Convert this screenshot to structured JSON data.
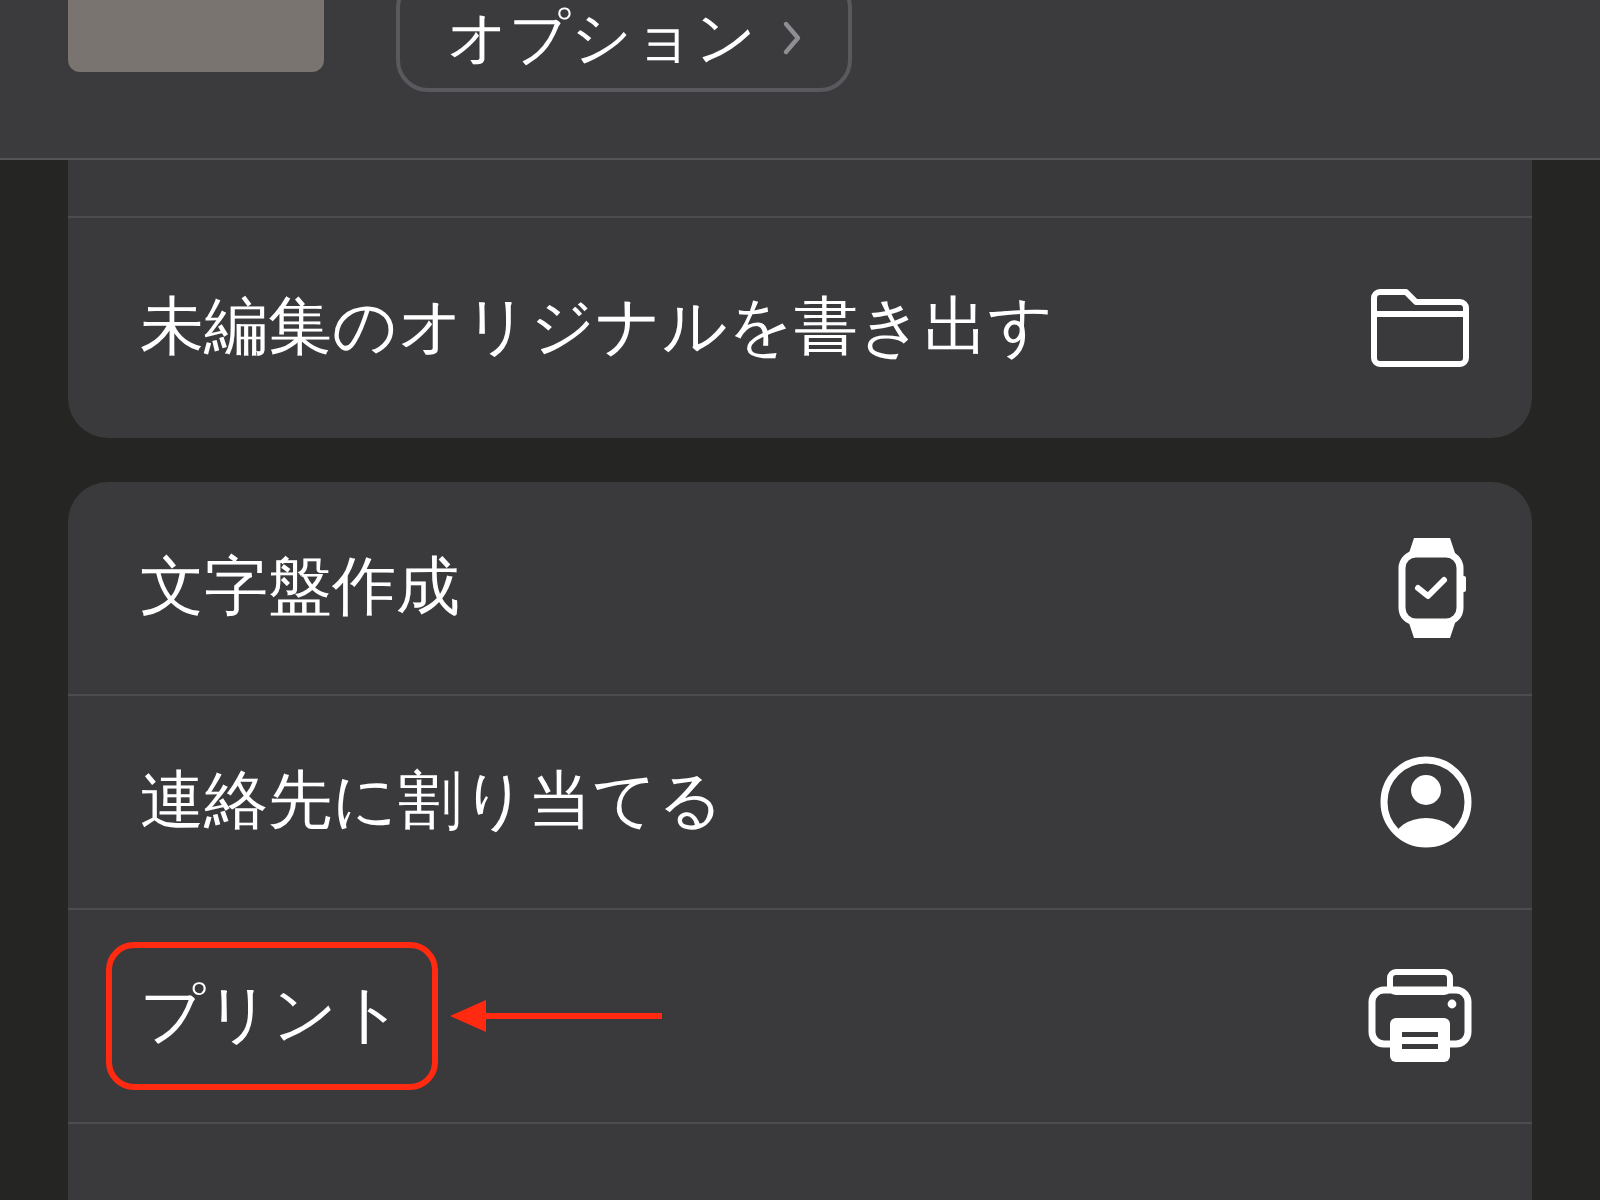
{
  "header": {
    "options_button": "オプション"
  },
  "groups": [
    {
      "items": [
        {
          "label": "未編集のオリジナルを書き出す",
          "kind": "folder",
          "highlighted": false
        }
      ]
    },
    {
      "items": [
        {
          "label": "文字盤作成",
          "kind": "watch",
          "highlighted": false
        },
        {
          "label": "連絡先に割り当てる",
          "kind": "person",
          "highlighted": false
        },
        {
          "label": "プリント",
          "kind": "printer",
          "highlighted": true
        }
      ]
    }
  ]
}
